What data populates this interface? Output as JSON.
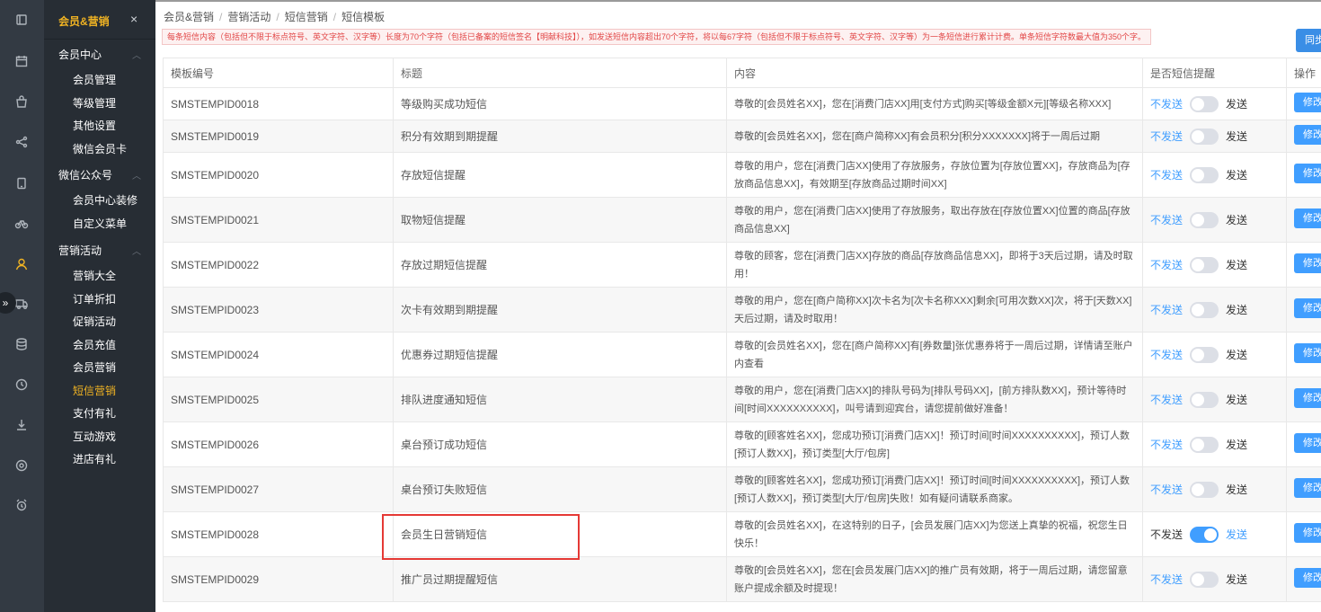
{
  "menu": {
    "title": "会员&营销",
    "close_label": "×",
    "groups": [
      {
        "label": "会员中心",
        "items": [
          "会员管理",
          "等级管理",
          "其他设置",
          "微信会员卡"
        ]
      },
      {
        "label": "微信公众号",
        "items": [
          "会员中心装修",
          "自定义菜单"
        ]
      },
      {
        "label": "营销活动",
        "items": [
          "营销大全",
          "订单折扣",
          "促销活动",
          "会员充值",
          "会员营销",
          "短信营销",
          "支付有礼",
          "互动游戏",
          "进店有礼"
        ]
      }
    ],
    "active_item": "短信营销"
  },
  "rail": {
    "icons": [
      "dashboard-icon",
      "calendar-icon",
      "bag-icon",
      "share-icon",
      "tablet-icon",
      "bike-icon",
      "user-icon",
      "truck-icon",
      "database-icon",
      "clock-icon",
      "download-icon",
      "settings-icon",
      "alarm-icon"
    ],
    "expand_label": "»"
  },
  "breadcrumb": [
    "会员&营销",
    "营销活动",
    "短信营销",
    "短信模板"
  ],
  "notice": "每条短信内容（包括但不限于标点符号、英文字符、汉字等）长度为70个字符（包括已备案的短信签名【明献科技】），如发送短信内容超出70个字符，将以每67字符（包括但不限于标点符号、英文字符、汉字等）为一条短信进行累计计费。单条短信字符数最大值为350个字。",
  "sync_button": "同步",
  "table": {
    "headers": [
      "模板编号",
      "标题",
      "内容",
      "是否短信提醒",
      "操作"
    ],
    "off_label": "不发送",
    "on_label": "发送",
    "edit_label": "修改",
    "rows": [
      {
        "id": "SMSTEMPID0018",
        "title": "等级购买成功短信",
        "content": "尊敬的[会员姓名XX]，您在[消费门店XX]用[支付方式]购买[等级金额X元][等级名称XXX]",
        "enabled": false
      },
      {
        "id": "SMSTEMPID0019",
        "title": "积分有效期到期提醒",
        "content": "尊敬的[会员姓名XX]，您在[商户简称XX]有会员积分[积分XXXXXXX]将于一周后过期",
        "enabled": false
      },
      {
        "id": "SMSTEMPID0020",
        "title": "存放短信提醒",
        "content": "尊敬的用户，您在[消费门店XX]使用了存放服务，存放位置为[存放位置XX]，存放商品为[存放商品信息XX]，有效期至[存放商品过期时间XX]",
        "enabled": false
      },
      {
        "id": "SMSTEMPID0021",
        "title": "取物短信提醒",
        "content": "尊敬的用户，您在[消费门店XX]使用了存放服务，取出存放在[存放位置XX]位置的商品[存放商品信息XX]",
        "enabled": false
      },
      {
        "id": "SMSTEMPID0022",
        "title": "存放过期短信提醒",
        "content": "尊敬的顾客，您在[消费门店XX]存放的商品[存放商品信息XX]，即将于3天后过期，请及时取用！",
        "enabled": false
      },
      {
        "id": "SMSTEMPID0023",
        "title": "次卡有效期到期提醒",
        "content": "尊敬的用户，您在[商户简称XX]次卡名为[次卡名称XXX]剩余[可用次数XX]次，将于[天数XX]天后过期，请及时取用！",
        "enabled": false
      },
      {
        "id": "SMSTEMPID0024",
        "title": "优惠券过期短信提醒",
        "content": "尊敬的[会员姓名XX]，您在[商户简称XX]有[券数量]张优惠券将于一周后过期，详情请至账户内查看",
        "enabled": false
      },
      {
        "id": "SMSTEMPID0025",
        "title": "排队进度通知短信",
        "content": "尊敬的用户，您在[消费门店XX]的排队号码为[排队号码XX]，[前方排队数XX]，预计等待时间[时间XXXXXXXXXX]，叫号请到迎宾台，请您提前做好准备！",
        "enabled": false
      },
      {
        "id": "SMSTEMPID0026",
        "title": "桌台预订成功短信",
        "content": "尊敬的[顾客姓名XX]，您成功预订[消费门店XX]！预订时间[时间XXXXXXXXXX]，预订人数[预订人数XX]，预订类型[大厅/包房]",
        "enabled": false
      },
      {
        "id": "SMSTEMPID0027",
        "title": "桌台预订失败短信",
        "content": "尊敬的[顾客姓名XX]，您成功预订[消费门店XX]！预订时间[时间XXXXXXXXXX]，预订人数[预订人数XX]，预订类型[大厅/包房]失败！如有疑问请联系商家。",
        "enabled": false
      },
      {
        "id": "SMSTEMPID0028",
        "title": "会员生日营销短信",
        "content": "尊敬的[会员姓名XX]，在这特别的日子，[会员发展门店XX]为您送上真挚的祝福，祝您生日快乐！",
        "enabled": true
      },
      {
        "id": "SMSTEMPID0029",
        "title": "推广员过期提醒短信",
        "content": "尊敬的[会员姓名XX]，您在[会员发展门店XX]的推广员有效期，将于一周后过期，请您留意账户提成余额及时提现！",
        "enabled": false
      }
    ]
  },
  "colors": {
    "accent": "#f0b323",
    "primary": "#409eff",
    "highlight": "#e53935",
    "notice_text": "#e24848"
  }
}
